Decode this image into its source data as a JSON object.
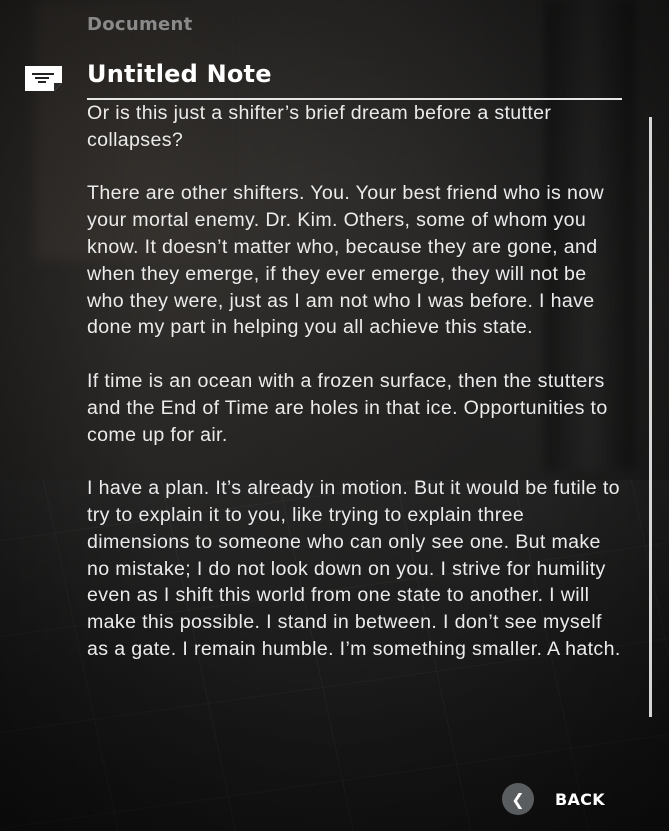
{
  "header": {
    "section_label": "Document",
    "title": "Untitled Note",
    "icon": "note-icon"
  },
  "document": {
    "paragraphs": [
      "Or is this just a shifter’s brief dream before a stutter collapses?",
      "There are other shifters. You. Your best friend who is now your mortal enemy. Dr. Kim. Others, some of whom you know. It doesn’t matter who, because they are gone, and when they emerge, if they ever emerge, they will not be who they were, just as I am not who I was before. I have done my part in helping you all achieve this state.",
      "If time is an ocean with a frozen surface, then the stutters and the End of Time are holes in that ice. Opportunities to come up for air.",
      "I have a plan. It’s already in motion. But it would be futile to try to explain it to you, like trying to explain three dimensions to someone who can only see one. But make no mistake; I do not look down on you. I strive for humility even as I shift this world from one state to another. I will make this possible. I stand in between. I don’t see myself as a gate. I remain humble. I’m something smaller. A hatch."
    ]
  },
  "footer": {
    "back_label": "BACK",
    "back_glyph": "❮",
    "back_icon": "chevron-left-icon"
  },
  "colors": {
    "accent_text": "#ffffff",
    "muted_text": "#8a8a8a",
    "button_circle": "#5a5d60"
  }
}
